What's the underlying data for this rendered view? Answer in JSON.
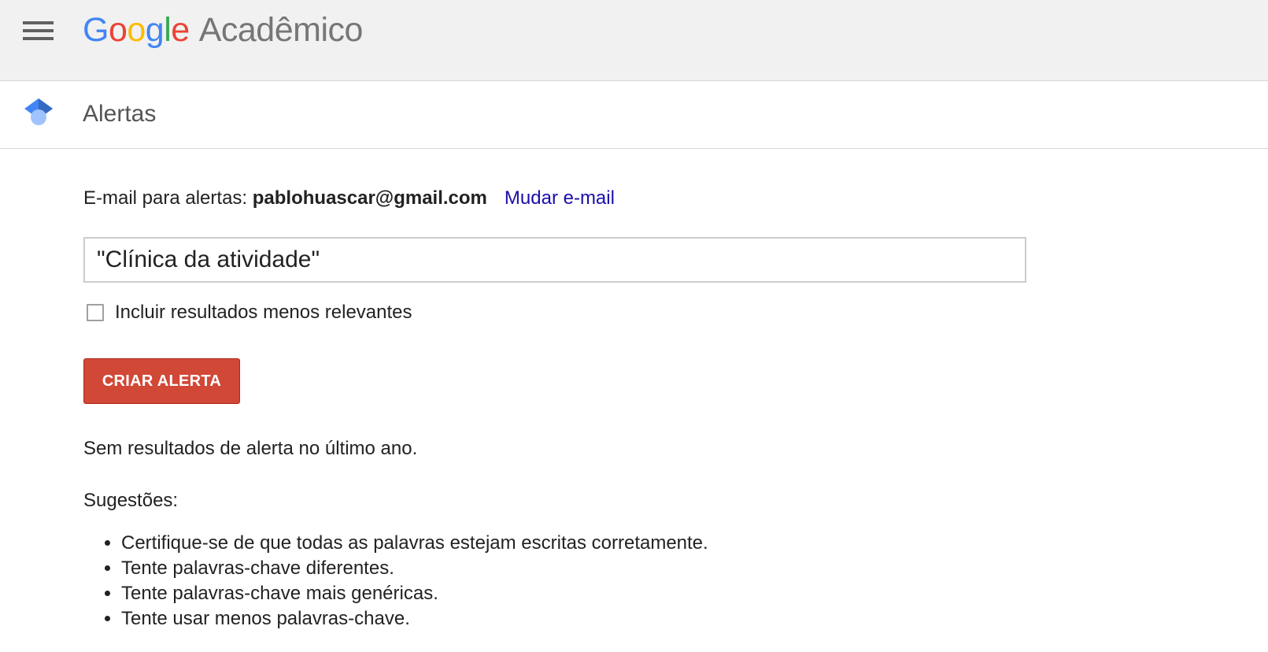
{
  "header": {
    "logo_letters": [
      {
        "char": "G",
        "color": "#4285f4"
      },
      {
        "char": "o",
        "color": "#ea4335"
      },
      {
        "char": "o",
        "color": "#fbbc05"
      },
      {
        "char": "g",
        "color": "#4285f4"
      },
      {
        "char": "l",
        "color": "#34a853"
      },
      {
        "char": "e",
        "color": "#ea4335"
      }
    ],
    "product_name": "Acadêmico",
    "menu_icon": "hamburger-menu-icon"
  },
  "subheader": {
    "icon": "scholar-cap-icon",
    "title": "Alertas"
  },
  "alert_form": {
    "email_label": "E-mail para alertas: ",
    "email_value": "pablohuascar@gmail.com",
    "change_email_label": "Mudar e-mail",
    "query_value": "\"Clínica da atividade\"",
    "include_less_relevant_label": "Incluir resultados menos relevantes",
    "include_less_relevant_checked": false,
    "create_button_label": "CRIAR ALERTA"
  },
  "results": {
    "no_results_text": "Sem resultados de alerta no último ano.",
    "suggestions_title": "Sugestões:",
    "suggestions": [
      "Certifique-se de que todas as palavras estejam escritas corretamente.",
      "Tente palavras-chave diferentes.",
      "Tente palavras-chave mais genéricas.",
      "Tente usar menos palavras-chave."
    ]
  },
  "colors": {
    "accent_red": "#d14836",
    "link_blue": "#1a0dab",
    "topbar_bg": "#f1f1f1"
  }
}
